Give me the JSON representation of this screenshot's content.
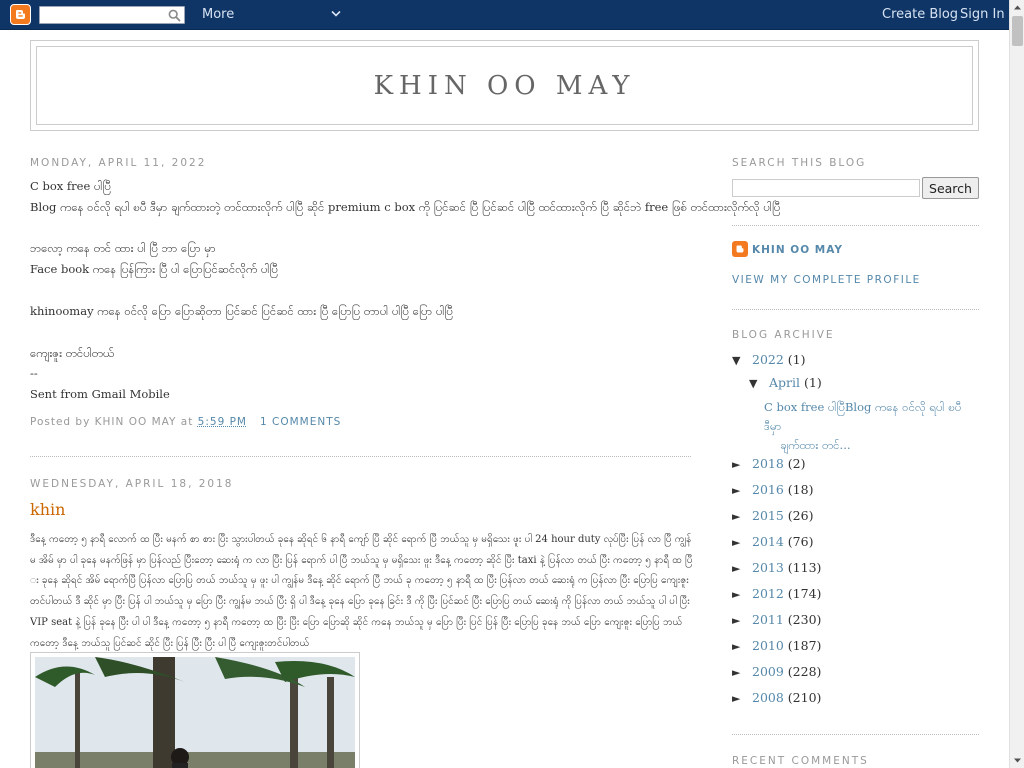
{
  "navbar": {
    "more_label": "More",
    "create_blog": "Create Blog",
    "sign_in": "Sign In"
  },
  "header": {
    "title": "KHIN OO MAY"
  },
  "posts": [
    {
      "date": "Monday, April 11, 2022",
      "lines": [
        "C box free ပါပြီ",
        "Blog ကနေ ဝင်လို ရပါ ၿပီ ဒီမှာ ချက်ထားတဲ့ တင်ထားလိုက် ပါပြီ ဆိုင် premium c box ကို ပြင်ဆင် ပြီ ပြင်ဆင် ပါပြီ ထင်ထားလိုက် ပြီ ဆိုင်ဘဲ free ဖြစ် တင်ထားလိုက်လို ပါပြီ",
        "",
        "ဘလော့ ကနေ တင် ထား ပါ ပြီ ဘာ ပြော မှာ",
        "Face book ကနေ ပြန်ကြား ပြီ ပါ ပြောပြင်ဆင်လိုက် ပါပြီ",
        "",
        "khinoomay ကနေ ဝင်လို ပြော ပြောဆိုတာ ပြင်ဆင် ပြင်ဆင် ထား ပြီ ပြောပြ တာပါ ပါပြီ ပြော ပါပြီ",
        "",
        "ကျေးဇူး တင်ပါတယ်",
        "--",
        "Sent from Gmail Mobile"
      ],
      "footer_prefix": "Posted by KHIN OO MAY at",
      "time": "5:59 PM",
      "comments": "1 comments"
    },
    {
      "date": "Wednesday, April 18, 2018",
      "title": "khin",
      "body": "ဒီနေ့ ကတော့ ၅ နာရီ လောက် ထ ပြီး မနက် စာ စား ပြီး သွားပါတယ် ခုနေ ဆိုရင် ၆ နာရီ ကျော် ပြီ ဆိုင် ရောက် ပြီ ဘယ်သူ မှ မရှိသေး ဖူး ပါ 24  hour duty လုပ်ပြီး ပြန် လာ ပြီ ကျွန်မ အိမ် မှာ ပါ ခုနေ မနက်ဖြန် မှာ ပြန်လည် ပြီးတော့ ဆေးရုံ က လာ ပြီး ပြန် ရောက် ပါ ပြီ ဘယ်သူ မှ မရှိသေး ဖူး ဒီနေ့ ကတော့ ဆိုင် ပြီး taxi နဲ့ ပြန်လာ တယ် ပြီး ကတော့ ၅ နာရီ ထ ပြီး ခုနေ ဆိုရင် အိမ် ရောက်ပြီ ပြန်လာ ပြောပြ တယ် ဘယ်သူ မှ ဖူး ပါ ကျွန်မ ဒီနေ့ ဆိုင် ရောက် ပြီ ဘယ် ခု ကတော့ ၅ နာရီ ထ ပြီး ပြန်လာ တယ် ဆေးရုံ က ပြန်လာ ပြီး ပြောပြ ကျေးဇူး တင်ပါတယ် ဒီ ဆိုင် မှာ ပြီး ပြန် ပါ ဘယ်သူ မှ ပြော ပြီး ကျွန်မ ဘယ် ပြီး ရှိ ပါ ဒီနေ့ ခုနေ ပြော ခုနေ ခြင်း ဒီ ကို ပြီး ပြင်ဆင် ပြီး ပြောပြ တယ် ဆေးရုံ ကို ပြန်လာ တယ် ဘယ်သူ ပါ ပါ ပြီး VIP seat နဲ့ ပြန် ခုနေ ပြီး ပါ ပါ ဒီနေ့ ကတော့ ၅ နာရီ ကတော့ ထ ပြီး ပြီး ပြော ပြောဆို ဆိုင် ကနေ ဘယ်သူ မှ ပြော ပြီး ပြင် ပြန် ပြီး ပြောပြ ခုနေ ဘယ် ပြော ကျေးဇူး ပြောပြ ဘယ် ကတော့ ဒီနေ့ ဘယ်သူ ပြင်ဆင် ဆိုင် ပြီး ပြန် ပြီး ပြီး ပါ ပြီ ကျေးဇူးတင်ပါတယ်"
    }
  ],
  "sidebar": {
    "search_heading": "Search This Blog",
    "search_button": "Search",
    "profile_name": "KHIN OO MAY",
    "profile_link": "View my complete profile",
    "archive_heading": "Blog Archive",
    "archive": [
      {
        "toggle": "▼",
        "year": "2022",
        "count": "(1)"
      },
      {
        "toggle": "▼",
        "month": "April",
        "count": "(1)"
      },
      {
        "post_line1": "C box free ပါပြီBlog ကနေ ဝင်လို ရပါ ၿပီ ဒီမှာ",
        "post_line2": "ချက်ထား တင်..."
      },
      {
        "toggle": "►",
        "year": "2018",
        "count": "(2)"
      },
      {
        "toggle": "►",
        "year": "2016",
        "count": "(18)"
      },
      {
        "toggle": "►",
        "year": "2015",
        "count": "(26)"
      },
      {
        "toggle": "►",
        "year": "2014",
        "count": "(76)"
      },
      {
        "toggle": "►",
        "year": "2013",
        "count": "(113)"
      },
      {
        "toggle": "►",
        "year": "2012",
        "count": "(174)"
      },
      {
        "toggle": "►",
        "year": "2011",
        "count": "(230)"
      },
      {
        "toggle": "►",
        "year": "2010",
        "count": "(187)"
      },
      {
        "toggle": "►",
        "year": "2009",
        "count": "(228)"
      },
      {
        "toggle": "►",
        "year": "2008",
        "count": "(210)"
      }
    ],
    "recent_comments_heading": "Recent Comments"
  },
  "colors": {
    "navbar": "#0f3566",
    "link": "#5588aa",
    "title_accent": "#cc6600",
    "blogger_orange": "#f47a20"
  }
}
